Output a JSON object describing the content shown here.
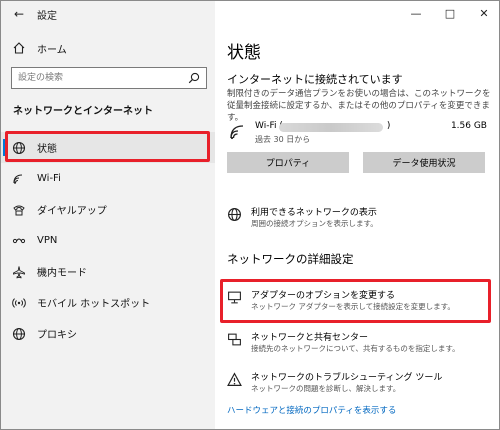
{
  "window": {
    "title": "設定"
  },
  "sidebar": {
    "home_label": "ホーム",
    "search_placeholder": "設定の検索",
    "section_heading": "ネットワークとインターネット",
    "items": [
      {
        "label": "状態",
        "icon": "globe-icon",
        "active": true
      },
      {
        "label": "Wi-Fi",
        "icon": "wifi-icon"
      },
      {
        "label": "ダイヤルアップ",
        "icon": "dialup-icon"
      },
      {
        "label": "VPN",
        "icon": "vpn-icon"
      },
      {
        "label": "機内モード",
        "icon": "airplane-icon"
      },
      {
        "label": "モバイル ホットスポット",
        "icon": "hotspot-icon"
      },
      {
        "label": "プロキシ",
        "icon": "globe-icon"
      }
    ]
  },
  "main": {
    "title": "状態",
    "connection_status": "インターネットに接続されています",
    "connection_desc": "制限付きのデータ通信プランをお使いの場合は、このネットワークを従量制金接続に設定するか、またはその他のプロパティを変更できます。",
    "network": {
      "name": "Wi-Fi (",
      "name_suffix": ")",
      "period": "過去 30 日から",
      "usage": "1.56 GB"
    },
    "buttons": {
      "properties": "プロパティ",
      "data_usage": "データ使用状況"
    },
    "available_networks": {
      "title": "利用できるネットワークの表示",
      "desc": "周囲の接続オプションを表示します。"
    },
    "advanced_heading": "ネットワークの詳細設定",
    "advanced_items": [
      {
        "title": "アダプターのオプションを変更する",
        "desc": "ネットワーク アダプターを表示して接続設定を変更します。",
        "icon": "adapter-icon"
      },
      {
        "title": "ネットワークと共有センター",
        "desc": "接続先のネットワークについて、共有するものを指定します。",
        "icon": "sharing-center-icon"
      },
      {
        "title": "ネットワークのトラブルシューティング ツール",
        "desc": "ネットワークの問題を診断し、解決します。",
        "icon": "warning-icon"
      }
    ],
    "footer_link": "ハードウェアと接続のプロパティを表示する"
  },
  "colors": {
    "accent": "#0078d7",
    "highlight": "#e8202a",
    "link": "#0067c0",
    "sidebar_bg": "#f2f2f2",
    "button_bg": "#cccccc"
  }
}
